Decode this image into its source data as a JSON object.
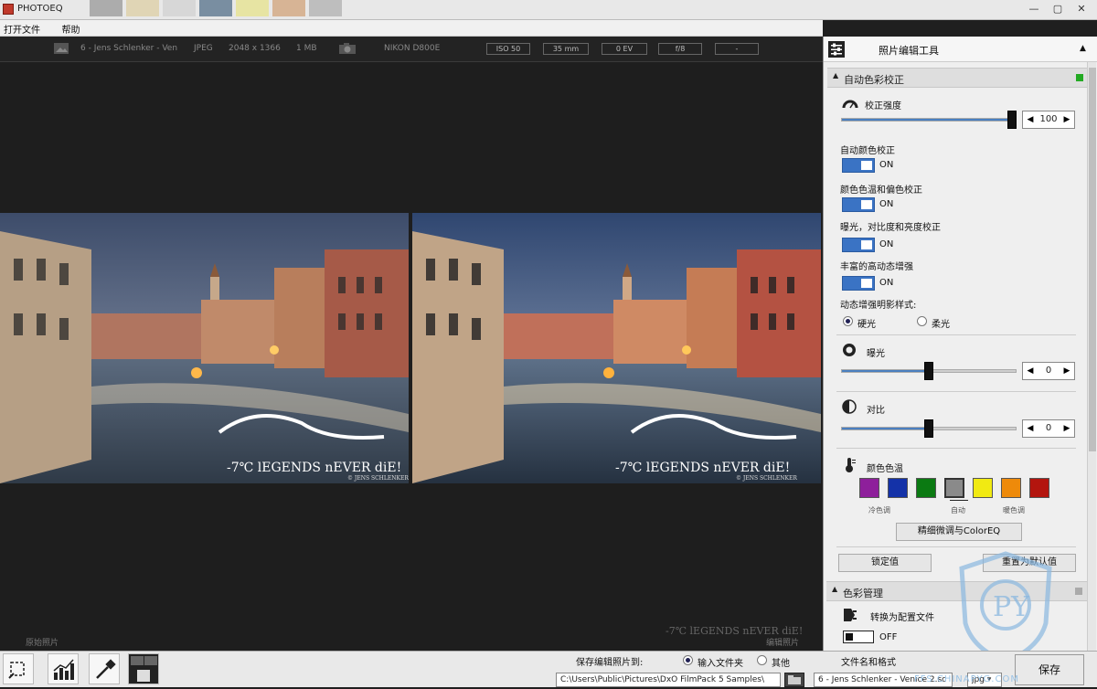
{
  "app": {
    "title": "PHOTOEQ"
  },
  "window": {
    "minimize": "—",
    "maximize": "▢",
    "close": "✕"
  },
  "menu": [
    "打开文件",
    "帮助"
  ],
  "infobar": {
    "filename": "6 - Jens Schlenker - Ven",
    "format": "JPEG",
    "dimensions": "2048 x 1366",
    "filesize": "1 MB",
    "camera": "NIKON D800E",
    "iso": "ISO 50",
    "focal": "35 mm",
    "ev": "0 EV",
    "aperture": "f/8"
  },
  "viewer": {
    "original_caption": "原始照片",
    "edited_caption": "编辑照片",
    "watermark_text": "-7℃ lEGENDS nEVER diE!",
    "photo_credit": "© JENS SCHLENKER"
  },
  "panel": {
    "title": "照片编辑工具",
    "auto_section": "自动色彩校正",
    "strength_label": "校正强度",
    "strength_value": "100",
    "strength_level": 100,
    "toggles": [
      {
        "label": "自动颜色校正",
        "state": "ON"
      },
      {
        "label": "颜色色温和偏色校正",
        "state": "ON"
      },
      {
        "label": "曝光，对比度和亮度校正",
        "state": "ON"
      },
      {
        "label": "丰富的高动态增强",
        "state": "ON"
      }
    ],
    "style_label": "动态增强明影样式:",
    "style_options": [
      "硬光",
      "柔光"
    ],
    "style_selected": "硬光",
    "exposure_label": "曝光",
    "exposure_value": "0",
    "contrast_label": "对比",
    "contrast_value": "0",
    "temp_label": "颜色色温",
    "swatches": [
      "#8e1f9b",
      "#1432a8",
      "#0b7a12",
      "#8a8a8a",
      "#f1ea12",
      "#ee8a0a",
      "#b3150e"
    ],
    "swatch_captions": {
      "cold": "冷色调",
      "auto": "自动",
      "warm": "暖色调"
    },
    "fine_tune_button": "精细微调与ColorEQ",
    "lock_button": "锁定值",
    "reset_button": "重置为默认值",
    "color_mgmt_section": "色彩管理",
    "convert_label": "转换为配置文件",
    "convert_state": "OFF",
    "accent": "#3a73c4",
    "active_indicator": "#22aa22"
  },
  "bottombar": {
    "save_to_label": "保存编辑照片到:",
    "dest_options": [
      "输入文件夹",
      "其他"
    ],
    "dest_selected": "输入文件夹",
    "filename_label": "文件名和格式",
    "path_value": "C:\\Users\\Public\\Pictures\\DxO FilmPack 5 Samples\\",
    "name_value": "6 - Jens Schlenker - Venice 2.sc",
    "format_value": "jpg",
    "save_button": "保存"
  },
  "logo_text": "FFS.CHINAPYG.COM"
}
